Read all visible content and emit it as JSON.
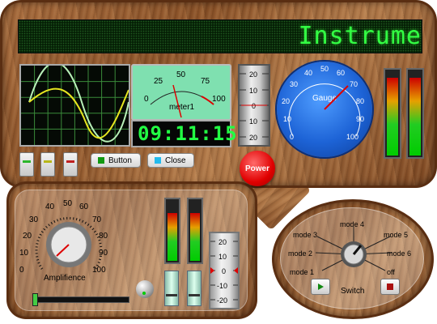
{
  "window": {
    "display_text": "Instrume"
  },
  "top": {
    "oscilloscope": {
      "label": "oscilloscope"
    },
    "meter": {
      "label": "meter1",
      "ticks": [
        "0",
        "25",
        "50",
        "75",
        "100"
      ],
      "value": 55
    },
    "clock": {
      "time": "09:11:15"
    },
    "vertical_scale": {
      "ticks": [
        "20",
        "10",
        "0",
        "10",
        "20"
      ]
    },
    "gauge": {
      "label": "Gauge",
      "ticks": [
        "0",
        "10",
        "20",
        "30",
        "40",
        "50",
        "60",
        "70",
        "80",
        "90",
        "100"
      ],
      "value": 80
    },
    "vu_meters": {
      "left_level": 0.92,
      "right_level": 0.92
    },
    "power_label": "Power",
    "button_label": "Button",
    "close_label": "Close",
    "toggle_colors": [
      "#2bb62b",
      "#b7b719",
      "#c02020"
    ]
  },
  "amplifier": {
    "label": "Amplifience",
    "ticks": [
      "0",
      "10",
      "20",
      "30",
      "40",
      "50",
      "60",
      "70",
      "80",
      "90",
      "100"
    ],
    "value": 35,
    "vu_levels": [
      0.8,
      0.8
    ],
    "slider_level": 0.0
  },
  "thermo_scale": {
    "ticks": [
      "20",
      "10",
      "0",
      "-10",
      "-20"
    ]
  },
  "switch": {
    "label": "Switch",
    "modes": [
      "mode 1",
      "mode 2",
      "mode 3",
      "mode 4",
      "mode 5",
      "mode 6",
      "off"
    ],
    "selected": "mode 6"
  },
  "colors": {
    "lcd_text": "#33ff44",
    "meter_face": "#7fe0b0",
    "gauge_face": "#1d63d6",
    "power": "#e00000"
  }
}
